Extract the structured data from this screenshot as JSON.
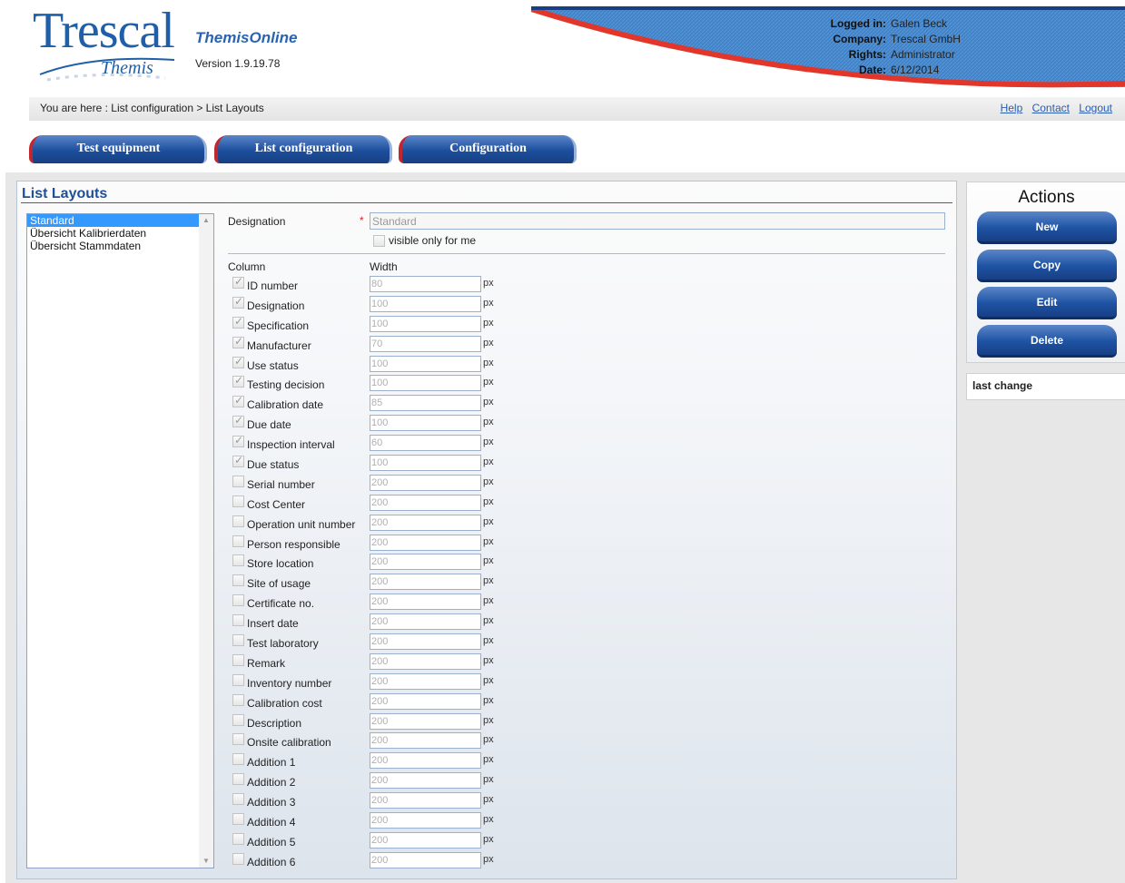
{
  "header": {
    "logo_text": "Trescal",
    "logo_sub": "Themis",
    "app_name": "ThemisOnline",
    "version": "Version 1.9.19.78",
    "user": [
      {
        "label": "Logged in:",
        "value": "Galen Beck"
      },
      {
        "label": "Company:",
        "value": "Trescal GmbH"
      },
      {
        "label": "Rights:",
        "value": "Administrator"
      },
      {
        "label": "Date:",
        "value": "6/12/2014"
      }
    ]
  },
  "breadcrumb": "You are here :  List configuration > List Layouts",
  "toplinks": {
    "help": "Help",
    "contact": "Contact",
    "logout": "Logout"
  },
  "tabs": [
    "Test equipment",
    "List configuration",
    "Configuration"
  ],
  "panel": {
    "title": "List Layouts",
    "layouts": [
      "Standard",
      "Übersicht Kalibrierdaten",
      "Übersicht Stammdaten"
    ],
    "selected_layout": "Standard",
    "designation_label": "Designation",
    "required_mark": "*",
    "designation_value": "Standard",
    "visible_only_label": "visible only for me",
    "col_header": "Column",
    "width_header": "Width",
    "px_unit": "px",
    "columns": [
      {
        "name": "ID number",
        "checked": true,
        "width": "80"
      },
      {
        "name": "Designation",
        "checked": true,
        "width": "100"
      },
      {
        "name": "Specification",
        "checked": true,
        "width": "100"
      },
      {
        "name": "Manufacturer",
        "checked": true,
        "width": "70"
      },
      {
        "name": "Use status",
        "checked": true,
        "width": "100"
      },
      {
        "name": "Testing decision",
        "checked": true,
        "width": "100"
      },
      {
        "name": "Calibration date",
        "checked": true,
        "width": "85"
      },
      {
        "name": "Due date",
        "checked": true,
        "width": "100"
      },
      {
        "name": "Inspection interval",
        "checked": true,
        "width": "60"
      },
      {
        "name": "Due status",
        "checked": true,
        "width": "100"
      },
      {
        "name": "Serial number",
        "checked": false,
        "width": "200"
      },
      {
        "name": "Cost Center",
        "checked": false,
        "width": "200"
      },
      {
        "name": "Operation unit number",
        "checked": false,
        "width": "200"
      },
      {
        "name": "Person responsible",
        "checked": false,
        "width": "200"
      },
      {
        "name": "Store location",
        "checked": false,
        "width": "200"
      },
      {
        "name": "Site of usage",
        "checked": false,
        "width": "200"
      },
      {
        "name": "Certificate no.",
        "checked": false,
        "width": "200"
      },
      {
        "name": "Insert date",
        "checked": false,
        "width": "200"
      },
      {
        "name": "Test laboratory",
        "checked": false,
        "width": "200"
      },
      {
        "name": "Remark",
        "checked": false,
        "width": "200"
      },
      {
        "name": "Inventory number",
        "checked": false,
        "width": "200"
      },
      {
        "name": "Calibration cost",
        "checked": false,
        "width": "200"
      },
      {
        "name": "Description",
        "checked": false,
        "width": "200"
      },
      {
        "name": "Onsite calibration",
        "checked": false,
        "width": "200"
      },
      {
        "name": "Addition 1",
        "checked": false,
        "width": "200"
      },
      {
        "name": "Addition 2",
        "checked": false,
        "width": "200"
      },
      {
        "name": "Addition 3",
        "checked": false,
        "width": "200"
      },
      {
        "name": "Addition 4",
        "checked": false,
        "width": "200"
      },
      {
        "name": "Addition 5",
        "checked": false,
        "width": "200"
      },
      {
        "name": "Addition 6",
        "checked": false,
        "width": "200"
      }
    ]
  },
  "actions": {
    "title": "Actions",
    "buttons": [
      "New",
      "Copy",
      "Edit",
      "Delete"
    ],
    "last_change_label": "last change"
  },
  "colors": {
    "accent_blue": "#1e53a3",
    "accent_red": "#d5302a",
    "selection": "#3399ff"
  }
}
